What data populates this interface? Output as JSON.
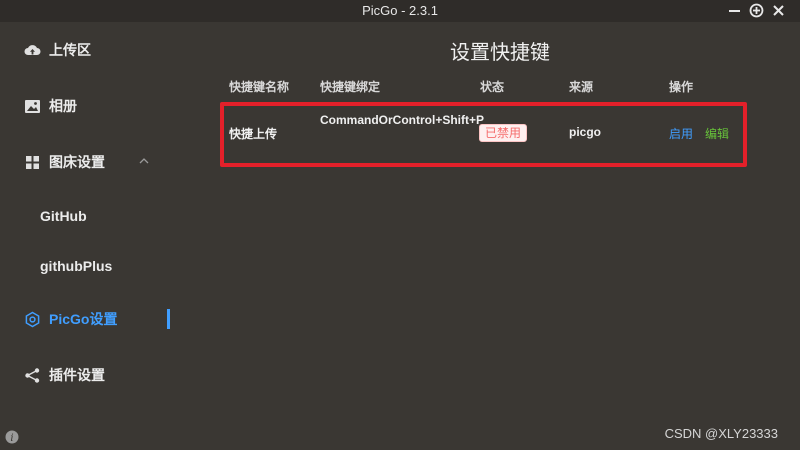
{
  "window": {
    "title": "PicGo - 2.3.1"
  },
  "sidebar": {
    "items": [
      {
        "label": "上传区"
      },
      {
        "label": "相册"
      },
      {
        "label": "图床设置"
      },
      {
        "label": "GitHub"
      },
      {
        "label": "githubPlus"
      },
      {
        "label": "PicGo设置"
      },
      {
        "label": "插件设置"
      }
    ]
  },
  "main": {
    "title": "设置快捷键",
    "columns": [
      "快捷键名称",
      "快捷键绑定",
      "状态",
      "来源",
      "操作"
    ],
    "rows": [
      {
        "name": "快捷上传",
        "binding": "CommandOrControl+Shift+P",
        "status": "已禁用",
        "source": "picgo",
        "actions": [
          "启用",
          "编辑"
        ]
      }
    ]
  },
  "watermark": "CSDN @XLY23333",
  "colors": {
    "accent": "#409eff",
    "danger": "#f56c6c",
    "success": "#67c23a",
    "highlight_box": "#e3202a"
  }
}
